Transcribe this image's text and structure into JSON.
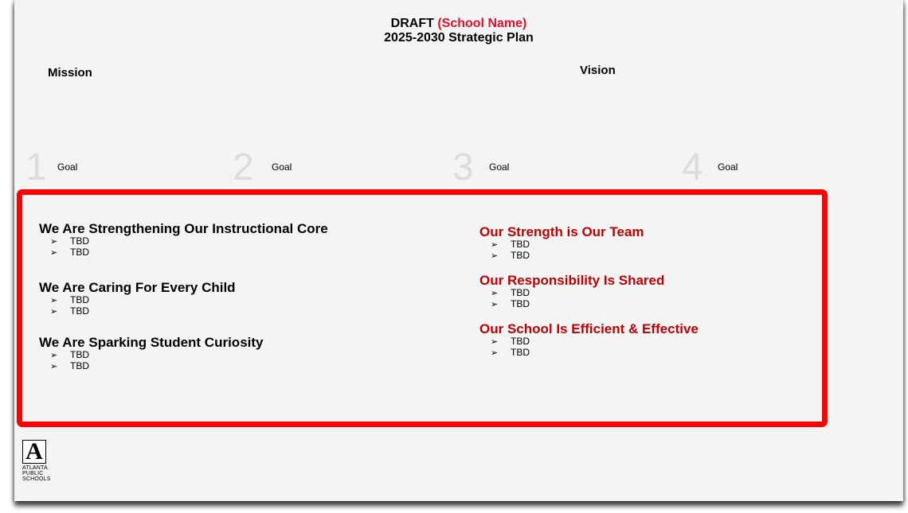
{
  "header": {
    "draft_label": "DRAFT",
    "school_name": "(School Name)",
    "plan_title": "2025-2030 Strategic Plan"
  },
  "mission": {
    "label": "Mission"
  },
  "vision": {
    "label": "Vision"
  },
  "goals": [
    {
      "number": "1",
      "label": "Goal"
    },
    {
      "number": "2",
      "label": "Goal"
    },
    {
      "number": "3",
      "label": "Goal"
    },
    {
      "number": "4",
      "label": "Goal"
    }
  ],
  "pillars_left": [
    {
      "title": "We Are Strengthening Our Instructional Core",
      "bullets": [
        "TBD",
        "TBD"
      ]
    },
    {
      "title": "We Are Caring For Every Child",
      "bullets": [
        "TBD",
        "TBD"
      ]
    },
    {
      "title": "We Are Sparking Student Curiosity",
      "bullets": [
        "TBD",
        "TBD"
      ]
    }
  ],
  "pillars_right": [
    {
      "title": "Our Strength is Our Team",
      "bullets": [
        "TBD",
        "TBD"
      ]
    },
    {
      "title": "Our Responsibility Is Shared",
      "bullets": [
        "TBD",
        "TBD"
      ]
    },
    {
      "title": "Our School Is Efficient & Effective",
      "bullets": [
        "TBD",
        "TBD"
      ]
    }
  ],
  "bullet_glyph": "➢",
  "logo": {
    "glyph": "A",
    "text_lines": [
      "ATLANTA",
      "PUBLIC",
      "SCHOOLS"
    ]
  },
  "colors": {
    "accent_red": "#e0102a",
    "border_red": "#ff0000",
    "right_title_red": "#c00000",
    "slide_bg": "#f4f4f4"
  }
}
